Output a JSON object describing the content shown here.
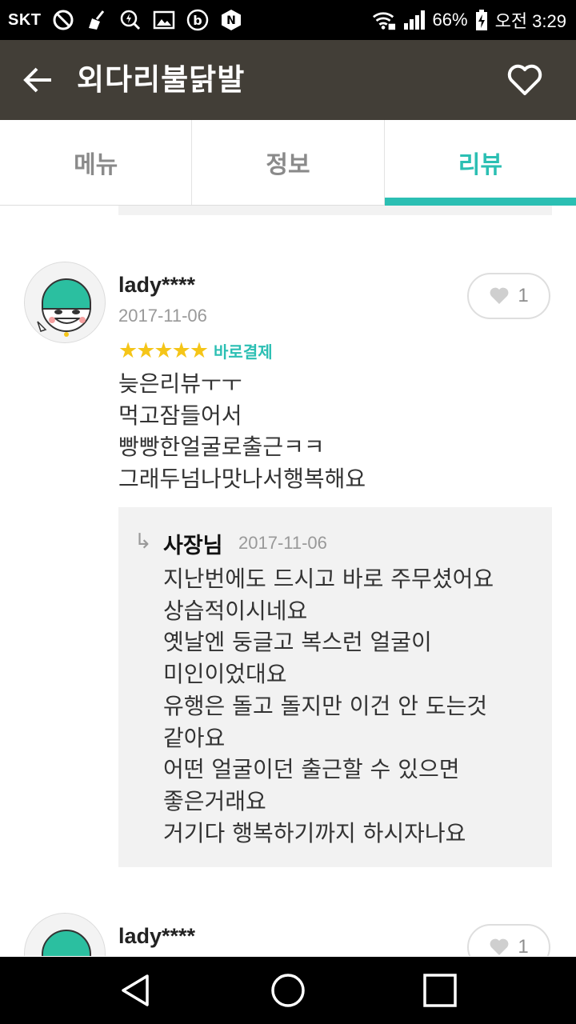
{
  "status_bar": {
    "carrier": "SKT",
    "battery": "66%",
    "time": "오전 3:29",
    "left_icons": [
      "no-sim-icon",
      "cleaner-icon",
      "search-bolt-icon",
      "gallery-icon",
      "b-app-icon",
      "n-app-icon"
    ],
    "right_icons": [
      "wifi-lock-icon",
      "signal-icon",
      "battery-charging-icon"
    ]
  },
  "header": {
    "title": "외다리불닭발",
    "back_icon": "arrow-left-icon",
    "favorite_icon": "heart-outline-icon"
  },
  "tabs": [
    {
      "label": "메뉴",
      "active": false
    },
    {
      "label": "정보",
      "active": false
    },
    {
      "label": "리뷰",
      "active": true
    }
  ],
  "colors": {
    "accent": "#2bbfb3",
    "header_bg": "#423e37",
    "star": "#f5c518",
    "reply_bg": "#f2f2f2"
  },
  "reviews": [
    {
      "author": "lady****",
      "date": "2017-11-06",
      "likes": "1",
      "stars": "★★★★★",
      "rating": 5,
      "badge": "바로결제",
      "lines": [
        "늦은리뷰ㅜㅜ",
        "먹고잠들어서",
        "빵빵한얼굴로출근ㅋㅋ",
        "그래두넘나맛나서행복해요"
      ],
      "reply": {
        "author": "사장님",
        "date": "2017-11-06",
        "lines": [
          "지난번에도 드시고 바로 주무셨어요",
          "상습적이시네요",
          "옛날엔 둥글고 복스런 얼굴이",
          "미인이었대요",
          "유행은 돌고 돌지만 이건 안 도는것",
          "같아요",
          "어떤 얼굴이던 출근할 수 있으면",
          "좋은거래요",
          "거기다 행복하기까지 하시자나요"
        ]
      }
    },
    {
      "author": "lady****",
      "likes": "1"
    }
  ],
  "nav": {
    "back_icon": "triangle-back-icon",
    "home_icon": "circle-home-icon",
    "recents_icon": "square-recents-icon"
  }
}
